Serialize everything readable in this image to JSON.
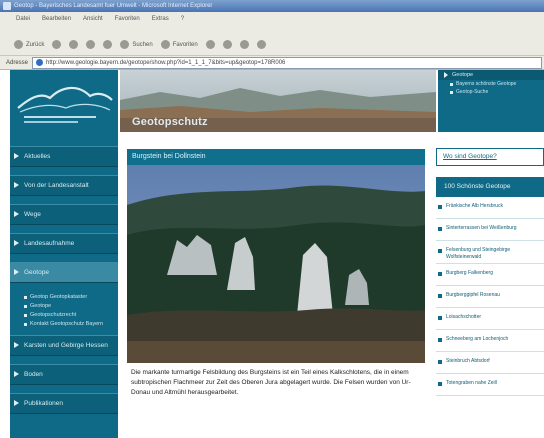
{
  "window": {
    "title": "Geotop - Bayerisches Landesamt fuer Umwelt - Microsoft Internet Explorer"
  },
  "menu": [
    "Datei",
    "Bearbeiten",
    "Ansicht",
    "Favoriten",
    "Extras",
    "?"
  ],
  "toolbar": {
    "back_label": "Zurück",
    "search_label": "Suchen",
    "favorites_label": "Favoriten"
  },
  "address": {
    "label": "Adresse",
    "url": "http://www.geologie.bayern.de/geotope/show.php?id=1_1_1_7&bits=up&geotop=178R006"
  },
  "banner": {
    "title": "Geotopschutz"
  },
  "left_nav": {
    "items": [
      "Aktuelles",
      "Von der Landesanstalt",
      "Wege",
      "Landesaufnahme",
      "Geotope",
      "Karsten und Gebirge Hessen",
      "Boden",
      "Publikationen"
    ],
    "active_index": 4,
    "subitems": [
      "Geotop Geotopkataster",
      "Geotope",
      "Geotopschutzrecht",
      "Kontakt Geotopschutz Bayern"
    ]
  },
  "right_top": {
    "heading": "Geotope",
    "links": [
      "Bayerns schönste Geotope",
      "Geotop-Suche"
    ]
  },
  "where_box": {
    "text": "Wo sind Geotope?"
  },
  "right_list": {
    "heading": "100 Schönste Geotope",
    "items": [
      "Fränkische Alb Hersbruck",
      "Sinterterrassen bei Weißenburg",
      "Felsenburg und Steingebirge Wolfsteinerwald",
      "Burgberg Falkenberg",
      "Burgberggipfel Rosenau",
      "Loisachschotter",
      "Schneeberg am Lochenjoch",
      "Steinbruch Abtsdorf",
      "Totengraben nahe Zeill"
    ]
  },
  "content": {
    "heading": "Burgstein bei Dollnstein",
    "caption": "Die markante turmartige Felsbildung des Burgsteins ist ein Teil eines Kalkschlotens, die in einem subtropischen Flachmeer zur Zeit des Oberen Jura abgelagert wurde. Die Felsen wurden von Ur-Donau und Altmühl herausgearbeitet."
  },
  "colors": {
    "primary": "#0e6a86",
    "primary_dark": "#0b5a72",
    "link": "#0e5d76"
  }
}
